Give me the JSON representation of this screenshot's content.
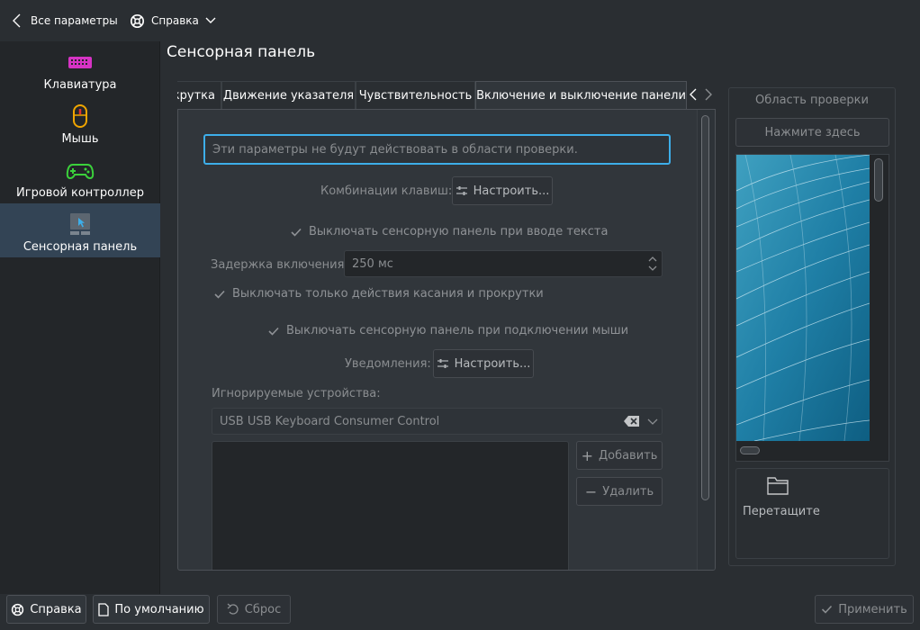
{
  "topbar": {
    "back_label": "Все параметры",
    "help_label": "Справка"
  },
  "page": {
    "title": "Сенсорная панель"
  },
  "sidebar": {
    "items": [
      {
        "label": "Клавиатура",
        "icon": "keyboard-icon"
      },
      {
        "label": "Мышь",
        "icon": "mouse-icon"
      },
      {
        "label": "Игровой контроллер",
        "icon": "gamepad-icon"
      },
      {
        "label": "Сенсорная панель",
        "icon": "touchpad-icon",
        "selected": true
      }
    ]
  },
  "tabs": [
    {
      "label": "крутка"
    },
    {
      "label": "Движение указателя"
    },
    {
      "label": "Чувствительность"
    },
    {
      "label": "Включение и выключение панели",
      "active": true
    }
  ],
  "form": {
    "info_placeholder": "Эти параметры не будут действовать в области проверки.",
    "shortcuts_label": "Комбинации клавиш:",
    "configure_label": "Настроить...",
    "disable_typing_label": "Выключать сенсорную панель при вводе текста",
    "delay_label": "Задержка включения:",
    "delay_value": "250 мс",
    "disable_tap_scroll_label": "Выключать только действия касания и прокрутки",
    "disable_mouse_label": "Выключать сенсорную панель при подключении мыши",
    "notifications_label": "Уведомления:",
    "notifications_configure_label": "Настроить...",
    "ignored_devices_label": "Игнорируемые устройства:",
    "device_value": "USB USB Keyboard Consumer Control",
    "add_label": "Добавить",
    "remove_label": "Удалить"
  },
  "test_area": {
    "title": "Область проверки",
    "click_label": "Нажмите здесь",
    "drag_label": "Перетащите"
  },
  "bottombar": {
    "help_label": "Справка",
    "defaults_label": "По умолчанию",
    "reset_label": "Сброс",
    "apply_label": "Применить"
  },
  "colors": {
    "accent": "#3daee9",
    "selection": "#334455",
    "background": "#2a2e32"
  }
}
